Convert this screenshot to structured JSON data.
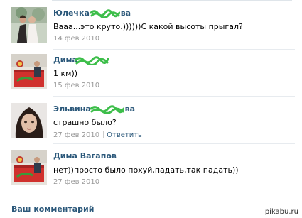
{
  "comments": [
    {
      "author": "Юлечка ",
      "author_tail": "ва",
      "text": "Вааа...это круто.))))))С какой высоты прыгал?",
      "date": "14 фев 2010",
      "reply": ""
    },
    {
      "author": "Дима ",
      "author_tail": "",
      "text": "1 км))",
      "date": "15 фев 2010",
      "reply": ""
    },
    {
      "author": "Эльвина ",
      "author_tail": "ва",
      "text": "страшно было?",
      "date": "27 фев 2010",
      "reply": "Ответить"
    },
    {
      "author": "Дима Вагапов",
      "author_tail": "",
      "text": "нет))просто было похуй,падать,так падать))",
      "date": "27 фев 2010",
      "reply": ""
    }
  ],
  "footer": {
    "your_comment": "Ваш комментарий"
  },
  "watermark": "pikabu.ru",
  "colors": {
    "link": "#2b587a",
    "meta": "#999999",
    "scribble": "#3dbe4a"
  }
}
